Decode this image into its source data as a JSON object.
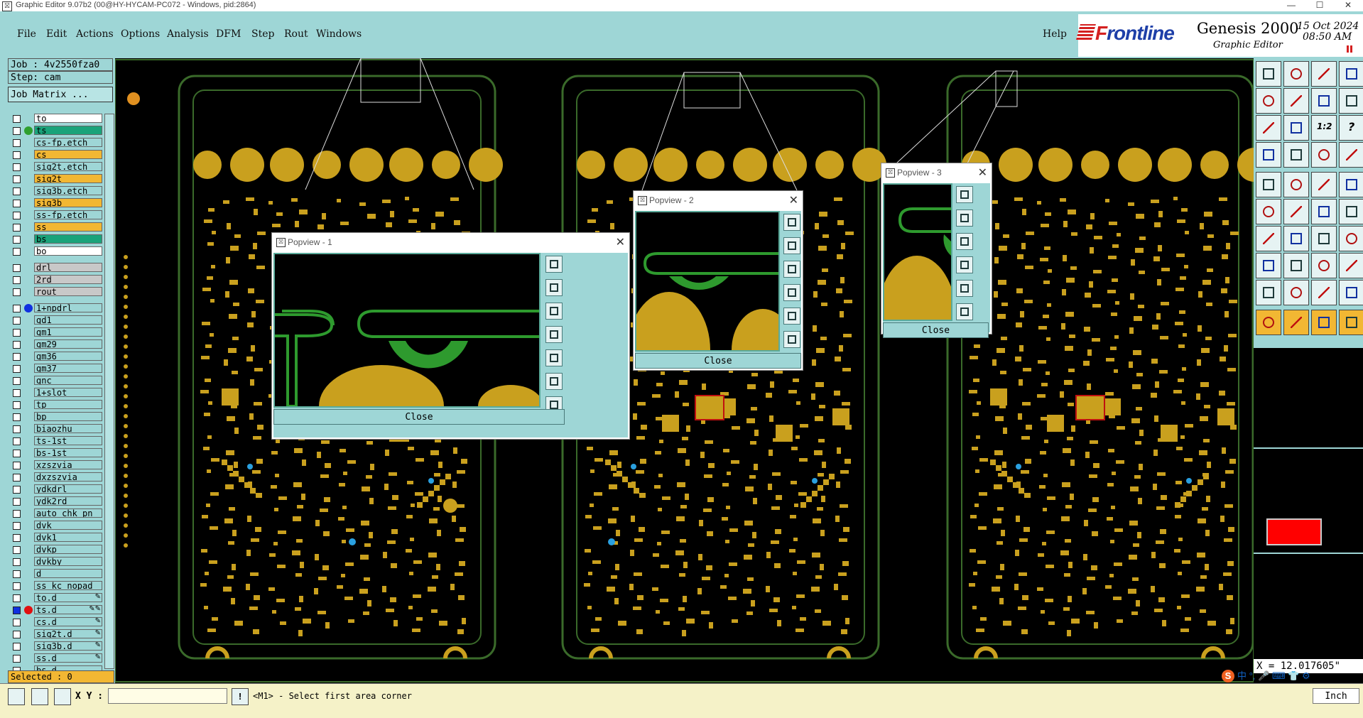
{
  "window": {
    "title": "Graphic Editor 9.07b2 (00@HY-HYCAM-PC072 - Windows, pid:2864)",
    "minimize": "—",
    "maximize": "☐",
    "close": "✕"
  },
  "menu": {
    "items": [
      "File",
      "Edit",
      "Actions",
      "Options",
      "Analysis",
      "DFM",
      "Step",
      "Rout",
      "Windows"
    ],
    "help": "Help"
  },
  "brand": {
    "logo": "Frontline",
    "product": "Genesis 2000",
    "subtitle": "Graphic Editor",
    "date": "15 Oct 2024",
    "time": "08:50 AM"
  },
  "job": {
    "job_label": "Job : 4v2550fza0",
    "step_label": "Step: cam",
    "matrix_button": "Job Matrix ..."
  },
  "layers": [
    {
      "name": "to",
      "color": "#ffffff",
      "dot": ""
    },
    {
      "name": "ts",
      "color": "#1aa37a",
      "dot": "#2fa02f"
    },
    {
      "name": "cs-fp.etch",
      "color": "#9ed6d6",
      "dot": ""
    },
    {
      "name": "cs",
      "color": "#f2b733",
      "dot": ""
    },
    {
      "name": "sig2t.etch",
      "color": "#9ed6d6",
      "dot": ""
    },
    {
      "name": "sig2t",
      "color": "#f2b733",
      "dot": ""
    },
    {
      "name": "sig3b.etch",
      "color": "#9ed6d6",
      "dot": ""
    },
    {
      "name": "sig3b",
      "color": "#f2b733",
      "dot": ""
    },
    {
      "name": "ss-fp.etch",
      "color": "#9ed6d6",
      "dot": ""
    },
    {
      "name": "ss",
      "color": "#f2b733",
      "dot": ""
    },
    {
      "name": "bs",
      "color": "#1aa37a",
      "dot": ""
    },
    {
      "name": "bo",
      "color": "#ffffff",
      "dot": ""
    },
    {
      "name": "drl",
      "color": "#c8c8c8",
      "dot": ""
    },
    {
      "name": "2rd",
      "color": "#c8c8c8",
      "dot": ""
    },
    {
      "name": "rout",
      "color": "#c8c8c8",
      "dot": ""
    },
    {
      "name": "1+npdrl",
      "color": "#9ed6d6",
      "dot": "#1030e0"
    },
    {
      "name": "gd1",
      "color": "#9ed6d6",
      "dot": ""
    },
    {
      "name": "gm1",
      "color": "#9ed6d6",
      "dot": ""
    },
    {
      "name": "gm29",
      "color": "#9ed6d6",
      "dot": ""
    },
    {
      "name": "gm36",
      "color": "#9ed6d6",
      "dot": ""
    },
    {
      "name": "gm37",
      "color": "#9ed6d6",
      "dot": ""
    },
    {
      "name": "gnc",
      "color": "#9ed6d6",
      "dot": ""
    },
    {
      "name": "1+slot",
      "color": "#9ed6d6",
      "dot": ""
    },
    {
      "name": "tp",
      "color": "#9ed6d6",
      "dot": ""
    },
    {
      "name": "bp",
      "color": "#9ed6d6",
      "dot": ""
    },
    {
      "name": "biaozhu",
      "color": "#9ed6d6",
      "dot": ""
    },
    {
      "name": "ts-1st",
      "color": "#9ed6d6",
      "dot": ""
    },
    {
      "name": "bs-1st",
      "color": "#9ed6d6",
      "dot": ""
    },
    {
      "name": "xzszvia",
      "color": "#9ed6d6",
      "dot": ""
    },
    {
      "name": "dxzszvia",
      "color": "#9ed6d6",
      "dot": ""
    },
    {
      "name": "ydkdrl",
      "color": "#9ed6d6",
      "dot": ""
    },
    {
      "name": "ydk2rd",
      "color": "#9ed6d6",
      "dot": ""
    },
    {
      "name": "auto_chk_pn",
      "color": "#9ed6d6",
      "dot": ""
    },
    {
      "name": "dvk",
      "color": "#9ed6d6",
      "dot": ""
    },
    {
      "name": "dvk1",
      "color": "#9ed6d6",
      "dot": ""
    },
    {
      "name": "dvkp",
      "color": "#9ed6d6",
      "dot": ""
    },
    {
      "name": "dvkby",
      "color": "#9ed6d6",
      "dot": ""
    },
    {
      "name": "d",
      "color": "#9ed6d6",
      "dot": ""
    },
    {
      "name": "ss_kc_nopad",
      "color": "#9ed6d6",
      "dot": ""
    },
    {
      "name": "to.d",
      "color": "#9ed6d6",
      "dot": "",
      "mark": "✎"
    },
    {
      "name": "ts.d",
      "color": "#9ed6d6",
      "dot": "#e01010",
      "mark": "✎✎"
    },
    {
      "name": "cs.d",
      "color": "#9ed6d6",
      "dot": "",
      "mark": "✎"
    },
    {
      "name": "sig2t.d",
      "color": "#9ed6d6",
      "dot": "",
      "mark": "✎"
    },
    {
      "name": "sig3b.d",
      "color": "#9ed6d6",
      "dot": "",
      "mark": "✎"
    },
    {
      "name": "ss.d",
      "color": "#9ed6d6",
      "dot": "",
      "mark": "✎"
    },
    {
      "name": "bs.d",
      "color": "#9ed6d6",
      "dot": ""
    }
  ],
  "selected": "Selected : 0",
  "popviews": [
    {
      "title": "Popview - 1",
      "close": "Close"
    },
    {
      "title": "Popview - 2",
      "close": "Close"
    },
    {
      "title": "Popview - 3",
      "close": "Close"
    }
  ],
  "right_panel": {
    "x_readout": "X = 12.017605\"",
    "ratio_button": "1:2",
    "help_button": "?"
  },
  "bottom": {
    "xy_label": "X Y :",
    "xy_value": "",
    "warn": "!",
    "prompt": "<M1> - Select first area corner",
    "units": "Inch",
    "ime": "中 °, 🎤 ⌨ 👕 ⚙"
  },
  "colors": {
    "panel": "#9ed6d6",
    "copper": "#c9a01e",
    "mask": "#2e9a2e",
    "outline": "#3a6a2a",
    "accent_yellow": "#f2b733",
    "accent_red": "#ff0000"
  }
}
